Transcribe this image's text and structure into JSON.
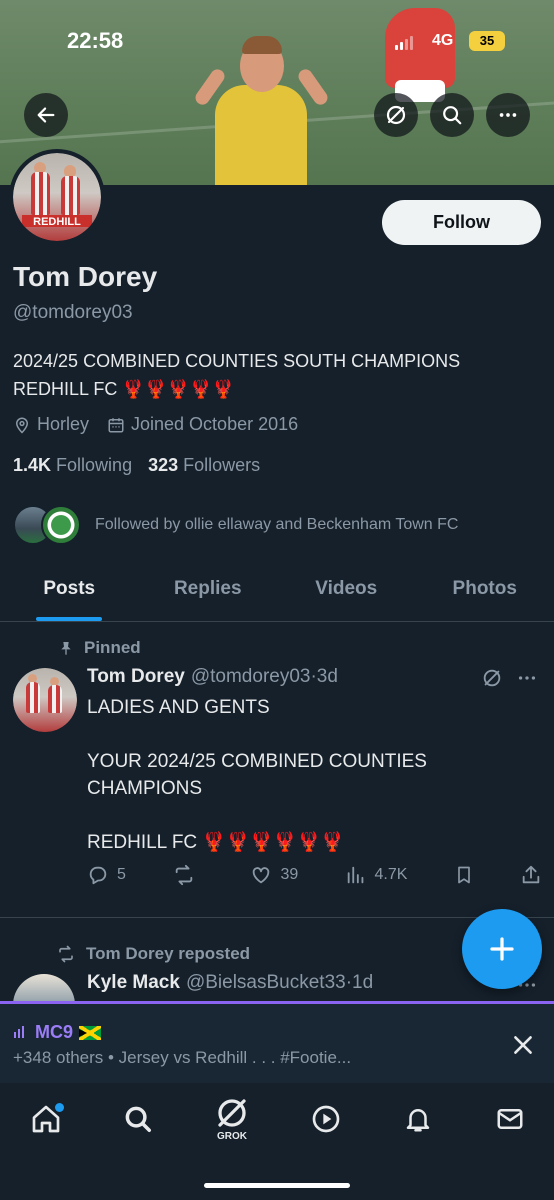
{
  "status_bar": {
    "time": "22:58",
    "network": "4G",
    "battery": "35"
  },
  "profile": {
    "name": "Tom Dorey",
    "handle": "@tomdorey03",
    "bio": "2024/25 COMBINED COUNTIES SOUTH CHAMPIONS REDHILL FC 🦞🦞🦞🦞🦞",
    "avatar_sign": "REDHILL",
    "location": "Horley",
    "joined": "Joined October 2016",
    "following_count": "1.4K",
    "following_label": "Following",
    "followers_count": "323",
    "followers_label": "Followers",
    "followed_by": "Followed by ollie ellaway and Beckenham Town FC",
    "follow_label": "Follow"
  },
  "tabs": [
    {
      "label": "Posts",
      "active": true
    },
    {
      "label": "Replies",
      "active": false
    },
    {
      "label": "Videos",
      "active": false
    },
    {
      "label": "Photos",
      "active": false
    }
  ],
  "pinned_tweet": {
    "pinned_label": "Pinned",
    "author": "Tom Dorey",
    "handle": "@tomdorey03",
    "time": "·3d",
    "lines": [
      "LADIES AND GENTS",
      "YOUR 2024/25 COMBINED COUNTIES CHAMPIONS",
      "REDHILL FC 🦞🦞🦞🦞🦞🦞"
    ],
    "replies": "5",
    "reposts": "",
    "likes": "39",
    "views": "4.7K"
  },
  "repost_tweet": {
    "repost_label": "Tom Dorey reposted",
    "author": "Kyle Mack",
    "handle": "@BielsasBucket33",
    "time": "·1d"
  },
  "space": {
    "title": "MC9",
    "subtitle": "+348 others • Jersey vs Redhill . . . #Footie..."
  },
  "nav": {
    "grok_label": "GROK"
  },
  "colors": {
    "background": "#15202b",
    "accent": "#1d9bf0",
    "space_accent": "#8a63f2",
    "muted": "#8b98a5"
  }
}
